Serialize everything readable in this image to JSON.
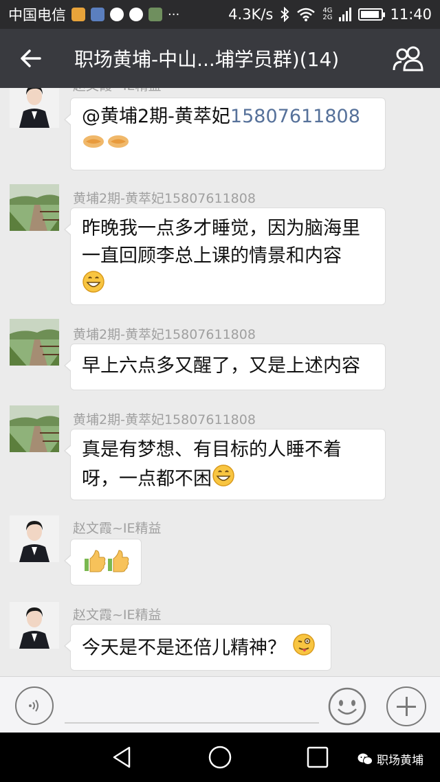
{
  "status_bar": {
    "carrier": "中国电信",
    "speed": "4.3K/s",
    "network_4g": "4G",
    "network_2g": "2G",
    "time": "11:40",
    "battery_level": 0.9
  },
  "title_bar": {
    "title": "职场黄埔-中山...埔学员群)(14)"
  },
  "messages": [
    {
      "sender": "赵文霞~IE精益",
      "mention": "@黄埔2期-黄萃妃",
      "mention_number": "15807611808",
      "emoji": "handshake-emoji"
    },
    {
      "sender": "黄埔2期-黄萃妃15807611808",
      "line1": "昨晚我一点多才睡觉，因为脑海里",
      "line2": "一直回顾李总上课的情景和内容",
      "emoji": "grin-emoji"
    },
    {
      "sender": "黄埔2期-黄萃妃15807611808",
      "line1": "早上六点多又醒了，又是上述内容"
    },
    {
      "sender": "黄埔2期-黄萃妃15807611808",
      "line1": "真是有梦想、有目标的人睡不着",
      "line2": "呀，一点都不困",
      "emoji": "grin-emoji"
    },
    {
      "sender": "赵文霞~IE精益",
      "emoji": "thumbs-up-emoji"
    },
    {
      "sender": "赵文霞~IE精益",
      "line1": "今天是不是还倍儿精神？",
      "emoji": "wink-tongue-emoji"
    }
  ],
  "input_bar": {
    "voice_icon": "voice-icon",
    "emoji_icon": "smiley-icon",
    "plus_icon": "plus-icon"
  },
  "watermark": {
    "text": "职场黄埔"
  },
  "colors": {
    "status_bg": "#2b2b2d",
    "title_bg": "#393a3f",
    "chat_bg": "#ebebeb",
    "number_link": "#56719a"
  }
}
